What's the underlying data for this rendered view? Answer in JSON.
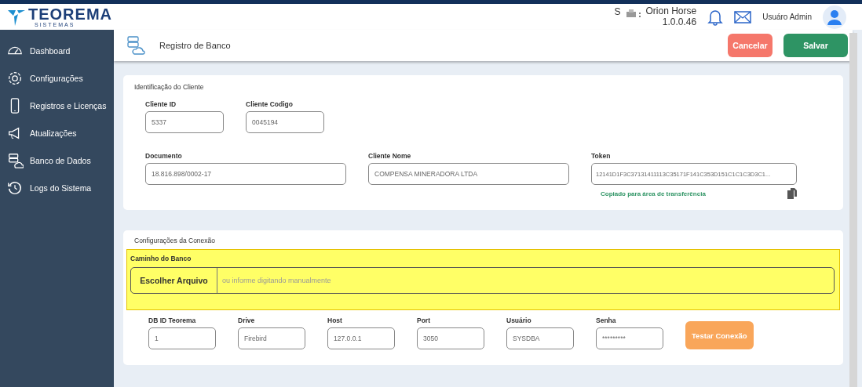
{
  "brand": {
    "name": "TEOREMA",
    "tagline": "SISTEMAS"
  },
  "topbar": {
    "prefix": "S",
    "app_name": "Orion Horse",
    "version": "1.0.0.46",
    "user": "Usuáro Admin"
  },
  "sidebar": {
    "items": [
      {
        "label": "Dashboard",
        "kind": "gauge"
      },
      {
        "label": "Configurações",
        "kind": "gear"
      },
      {
        "label": "Registros e Licenças",
        "kind": "phone"
      },
      {
        "label": "Atualizações",
        "kind": "megaphone"
      },
      {
        "label": "Banco de Dados",
        "kind": "database"
      },
      {
        "label": "Logs do Sistema",
        "kind": "history"
      }
    ]
  },
  "page": {
    "title": "Registro de Banco",
    "buttons": [
      {
        "label": "Cancelar",
        "kind": "cancel"
      },
      {
        "label": "Salvar",
        "kind": "save"
      }
    ]
  },
  "client_section": {
    "title": "Identificação do Cliente",
    "row_1": [
      {
        "label": "Cliente ID",
        "value": "5337"
      },
      {
        "label": "Cliente Codigo",
        "value": "0045194"
      }
    ],
    "row_2": [
      {
        "label": "Documento",
        "value": "18.816.898/0002-17"
      },
      {
        "label": "Cliente Nome",
        "value": "COMPENSA MINERADORA LTDA"
      },
      {
        "label": "Token",
        "value": "12141D1F3C37131411113C35171F141C353D151C1C1C3D3C1..."
      }
    ],
    "copy_message": "Copiado para área de transferência"
  },
  "connection_section": {
    "title": "Configurações da Conexão",
    "path": {
      "label": "Caminho do Banco",
      "button": "Escolher Arquivo",
      "placeholder": "ou informe digitando manualmente",
      "highlighted": true
    },
    "fields": [
      {
        "label": "DB ID Teorema",
        "value": "1"
      },
      {
        "label": "Drive",
        "value": "Firebird"
      },
      {
        "label": "Host",
        "value": "127.0.0.1"
      },
      {
        "label": "Port",
        "value": "3050"
      },
      {
        "label": "Usuário",
        "value": "SYSDBA"
      },
      {
        "label": "Senha",
        "value": "*********"
      }
    ],
    "test_button": "Testar Conexão"
  }
}
